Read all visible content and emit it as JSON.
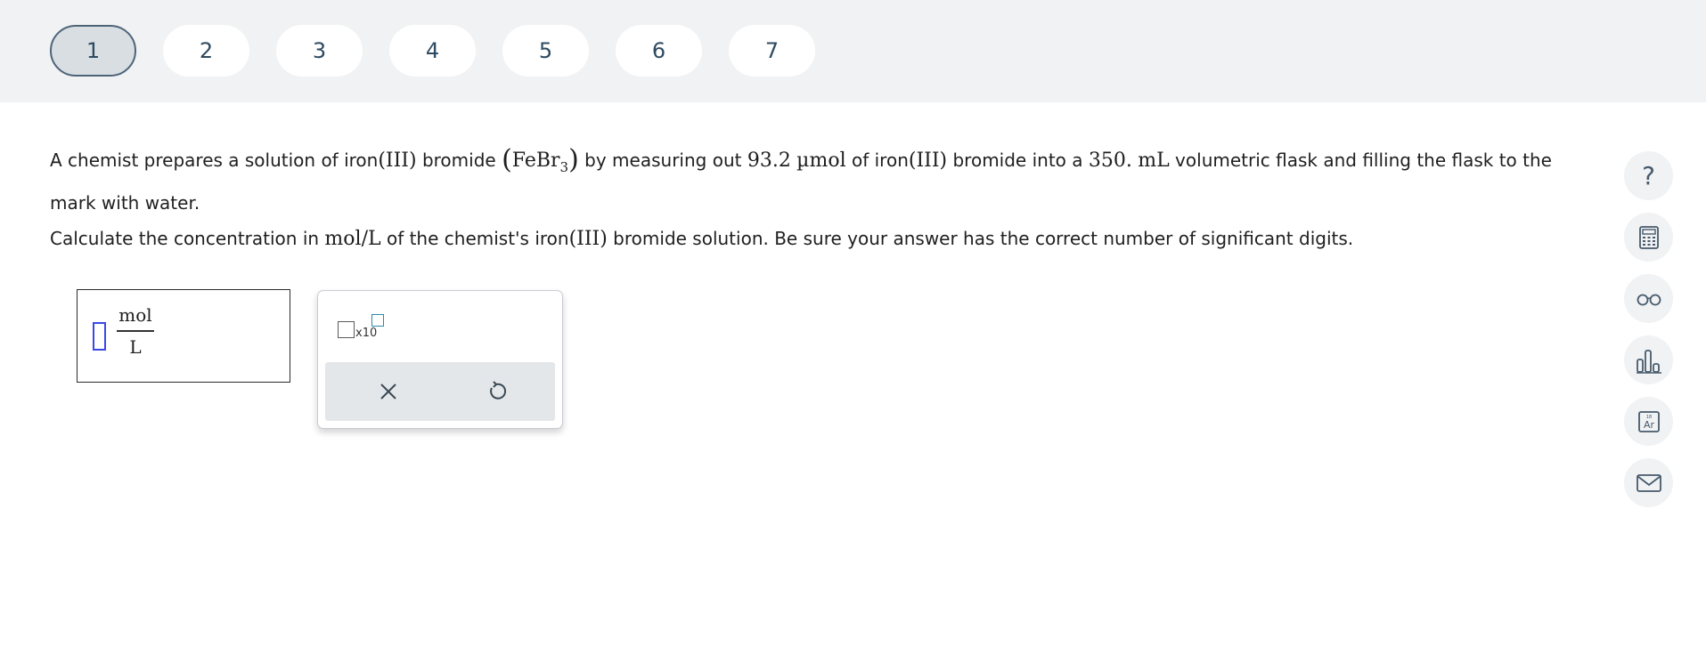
{
  "question_nav": {
    "items": [
      "1",
      "2",
      "3",
      "4",
      "5",
      "6",
      "7"
    ],
    "active_index": 0
  },
  "problem": {
    "p1_a": "A chemist prepares a solution of iron",
    "p1_iii_1": "(III)",
    "p1_b": " bromide ",
    "formula_open": "(",
    "formula_text": "FeBr",
    "formula_sub": "3",
    "formula_close": ")",
    "p1_c": " by measuring out ",
    "amount": "93.2",
    "amount_unit": "µmol",
    "p1_d": " of iron",
    "p1_iii_2": "(III)",
    "p1_e": " bromide into a ",
    "volume": "350.",
    "volume_unit": "mL",
    "p1_f": " volumetric flask and filling the flask to the mark with water.",
    "p2_a": "Calculate the concentration in ",
    "conc_unit": "mol/L",
    "p2_b": " of the chemist's iron",
    "p2_iii": "(III)",
    "p2_c": " bromide solution. Be sure your answer has the correct number of significant digits."
  },
  "answer": {
    "unit_numerator": "mol",
    "unit_denominator": "L"
  },
  "palette": {
    "sci_label": "x10",
    "clear_icon": "close-icon",
    "undo_icon": "undo-icon"
  },
  "tools": {
    "help": "?",
    "icons": [
      "help-icon",
      "calculator-icon",
      "glasses-icon",
      "bar-chart-icon",
      "periodic-table-icon",
      "mail-icon"
    ],
    "periodic_label": "Ar",
    "periodic_number": "18"
  },
  "colors": {
    "topbar_bg": "#f1f2f3",
    "nav_text": "#2e4a60",
    "active_border": "#4d6478",
    "cursor": "#3a48e8",
    "exp_box": "#2a8aa8",
    "tool_bg": "#f0f2f4"
  }
}
